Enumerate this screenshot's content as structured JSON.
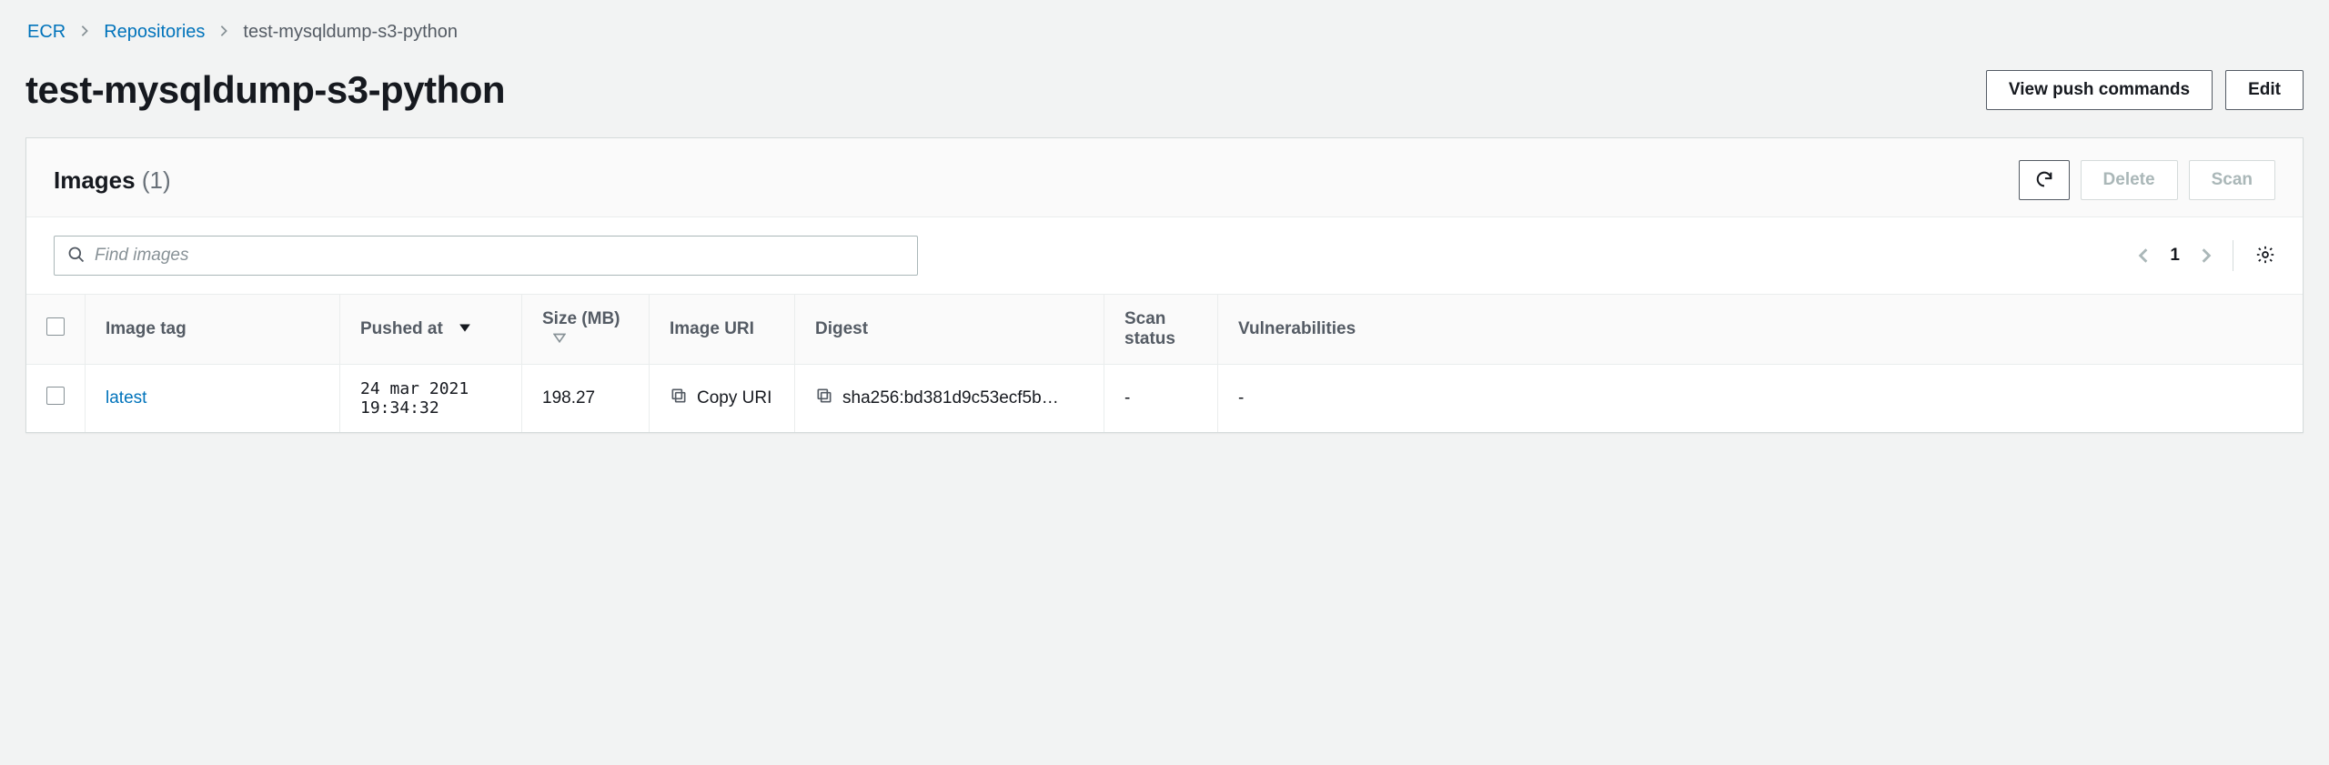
{
  "breadcrumb": {
    "root": "ECR",
    "repos": "Repositories",
    "current": "test-mysqldump-s3-python"
  },
  "header": {
    "title": "test-mysqldump-s3-python",
    "view_push": "View push commands",
    "edit": "Edit"
  },
  "panel": {
    "title": "Images",
    "count": "(1)",
    "delete": "Delete",
    "scan": "Scan"
  },
  "toolbar": {
    "search_placeholder": "Find images",
    "page": "1"
  },
  "columns": {
    "tag": "Image tag",
    "pushed": "Pushed at",
    "size": "Size (MB)",
    "uri": "Image URI",
    "digest": "Digest",
    "scan": "Scan status",
    "vuln": "Vulnerabilities"
  },
  "rows": [
    {
      "tag": "latest",
      "pushed": "24 mar 2021 19:34:32",
      "size": "198.27",
      "uri_action": "Copy URI",
      "digest": "sha256:bd381d9c53ecf5b…",
      "scan": "-",
      "vuln": "-"
    }
  ]
}
